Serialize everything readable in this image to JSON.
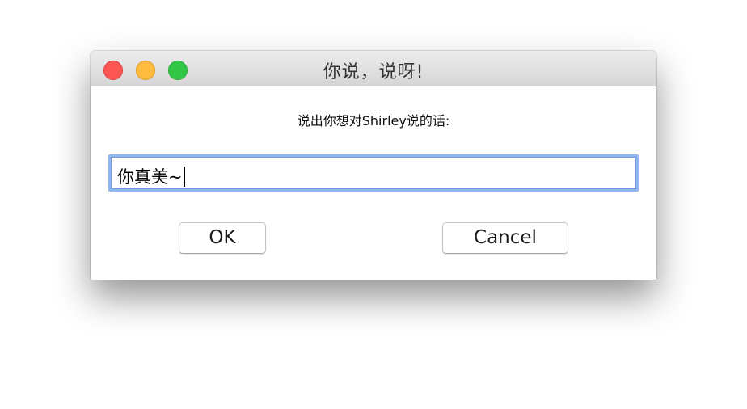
{
  "window": {
    "title": "你说，说呀!"
  },
  "dialog": {
    "prompt": "说出你想对Shirley说的话:",
    "entry_value": "你真美~",
    "ok_label": "OK",
    "cancel_label": "Cancel"
  },
  "icons": {
    "close": "traffic-light-close",
    "minimize": "traffic-light-minimize",
    "zoom": "traffic-light-zoom"
  },
  "colors": {
    "close": "#fc5753",
    "minimize": "#fdbc40",
    "zoom": "#33c748",
    "focus_ring": "#90b8ee"
  }
}
